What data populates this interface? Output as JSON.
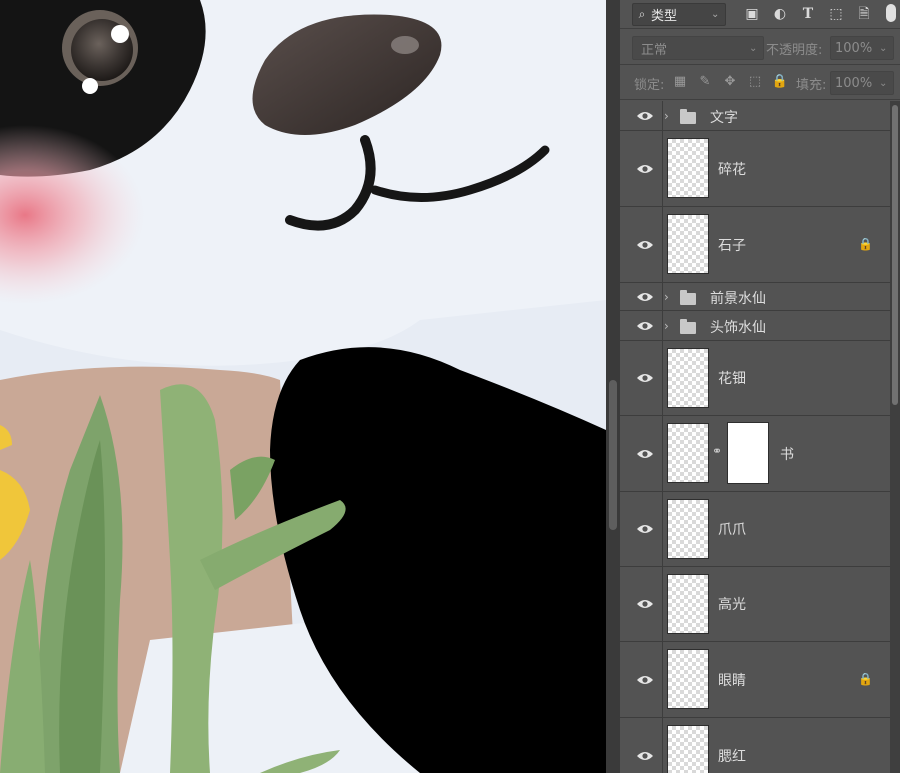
{
  "filter_bar": {
    "filter_type_label": "类型",
    "icons": [
      "image-filter-icon",
      "adjustment-filter-icon",
      "type-filter-icon",
      "shape-filter-icon",
      "smart-object-filter-icon"
    ]
  },
  "blend": {
    "mode": "正常",
    "opacity_label": "不透明度:",
    "opacity_value": "100%"
  },
  "lock_row": {
    "lock_label": "锁定:",
    "fill_label": "填充:",
    "fill_value": "100%"
  },
  "layers": [
    {
      "name": "文字",
      "type": "group",
      "locked": false
    },
    {
      "name": "碎花",
      "type": "layer",
      "locked": false
    },
    {
      "name": "石子",
      "type": "layer",
      "locked": true
    },
    {
      "name": "前景水仙",
      "type": "group",
      "locked": false
    },
    {
      "name": "头饰水仙",
      "type": "group",
      "locked": false
    },
    {
      "name": "花钿",
      "type": "layer",
      "locked": false
    },
    {
      "name": "书",
      "type": "layer_with_mask",
      "locked": false
    },
    {
      "name": "爪爪",
      "type": "layer",
      "locked": false
    },
    {
      "name": "高光",
      "type": "layer",
      "locked": false
    },
    {
      "name": "眼睛",
      "type": "layer",
      "locked": true
    },
    {
      "name": "腮红",
      "type": "layer",
      "locked": false
    }
  ]
}
